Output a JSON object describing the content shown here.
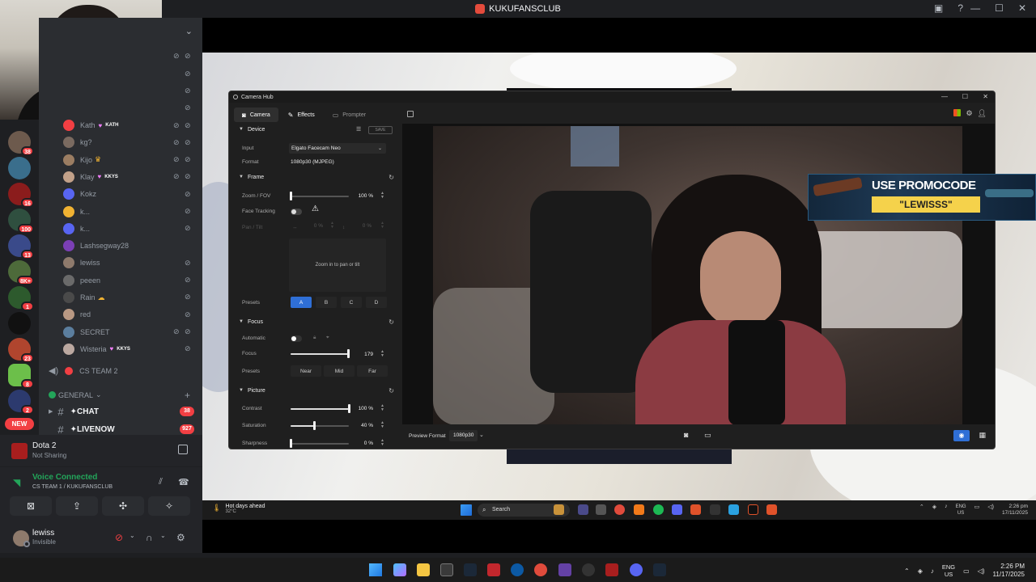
{
  "window": {
    "title": "KUKUFANSCLUB"
  },
  "server_rail": {
    "badges": [
      "38",
      "16",
      "100",
      "13",
      "8K+",
      "1",
      "23",
      "8",
      "2"
    ],
    "new_label": "NEW"
  },
  "voice_channel_users": [
    {
      "name": "Kath",
      "tag": "KATH",
      "heart": true,
      "color": "#f23f43"
    },
    {
      "name": "kg?",
      "color": "#7a6a60"
    },
    {
      "name": "Kijo",
      "color": "#9b7d62",
      "crown": "♛"
    },
    {
      "name": "Klay",
      "tag": "KKYS",
      "heart": true,
      "color": "#c2a189"
    },
    {
      "name": "Kokz",
      "color": "#5865f2"
    },
    {
      "name": "k...",
      "color": "#f0b232"
    },
    {
      "name": "k...",
      "color": "#5865f2"
    },
    {
      "name": "Lashsegway28",
      "color": "#7b3fb5"
    },
    {
      "name": "lewiss",
      "color": "#8e7a6c"
    },
    {
      "name": "peeen",
      "color": "#6a6a6a"
    },
    {
      "name": "Rain",
      "color": "#4a4a4a",
      "crown": "☁"
    },
    {
      "name": "red",
      "color": "#b89883"
    },
    {
      "name": "SECRET",
      "color": "#5b7e9e"
    },
    {
      "name": "Wisteria",
      "tag": "KKYS",
      "heart": true,
      "color": "#bba8a0"
    }
  ],
  "categories": {
    "cs_team_2": "CS TEAM 2",
    "general": "GENERAL"
  },
  "channels": [
    {
      "name": "✦CHAT",
      "badge": "38",
      "emoji": "📝"
    },
    {
      "name": "✦LIVENOW",
      "badge": "927",
      "emoji": "🎥"
    }
  ],
  "activity": {
    "title": "Dota 2",
    "subtitle": "Not Sharing"
  },
  "voice": {
    "status": "Voice Connected",
    "channel": "CS TEAM 1 / KUKUFANSCLUB"
  },
  "user": {
    "name": "lewiss",
    "status": "Invisible"
  },
  "camhub": {
    "title": "Camera Hub",
    "tabs": [
      {
        "label": "Camera",
        "icon": "camera-icon"
      },
      {
        "label": "Effects",
        "icon": "magic-wand-icon"
      },
      {
        "label": "Prompter",
        "icon": "prompter-icon"
      }
    ],
    "device": {
      "header": "Device",
      "save_label": "SAVE",
      "input_label": "Input",
      "input_value": "Elgato Facecam Neo",
      "format_label": "Format",
      "format_value": "1080p30 (MJPEG)"
    },
    "frame": {
      "header": "Frame",
      "zoom_label": "Zoom / FOV",
      "zoom_value": "100 %",
      "zoom_level": 0,
      "face_tracking_label": "Face Tracking",
      "pan_tilt_label": "Pan / Tilt",
      "pan_value": "0 %",
      "tilt_value": "0 %",
      "pan_hint": "Zoom in to pan or tilt",
      "presets_label": "Presets",
      "presets": [
        "A",
        "B",
        "C",
        "D"
      ]
    },
    "focus": {
      "header": "Focus",
      "automatic_label": "Automatic",
      "focus_label": "Focus",
      "focus_value": "179",
      "focus_level": 0.98,
      "presets_label": "Presets",
      "presets": [
        "Near",
        "Mid",
        "Far"
      ]
    },
    "picture": {
      "header": "Picture",
      "contrast_label": "Contrast",
      "contrast_value": "100 %",
      "contrast_level": 1.0,
      "saturation_label": "Saturation",
      "saturation_value": "40 %",
      "saturation_level": 0.4,
      "sharpness_label": "Sharpness",
      "sharpness_value": "0 %",
      "sharpness_level": 0
    },
    "preview_format_label": "Preview Format",
    "preview_format_value": "1080p30"
  },
  "promo": {
    "line1": "USE PROMOCODE",
    "line2": "\"LEWISSS\""
  },
  "inner_taskbar": {
    "weather_title": "Hot days ahead",
    "weather_temp": "32°C",
    "search": "Search",
    "lang1": "ENG",
    "lang2": "US",
    "time": "2:26 pm",
    "date": "17/11/2025"
  },
  "host_taskbar": {
    "lang1": "ENG",
    "lang2": "US",
    "time": "2:26 PM",
    "date": "11/17/2025"
  }
}
